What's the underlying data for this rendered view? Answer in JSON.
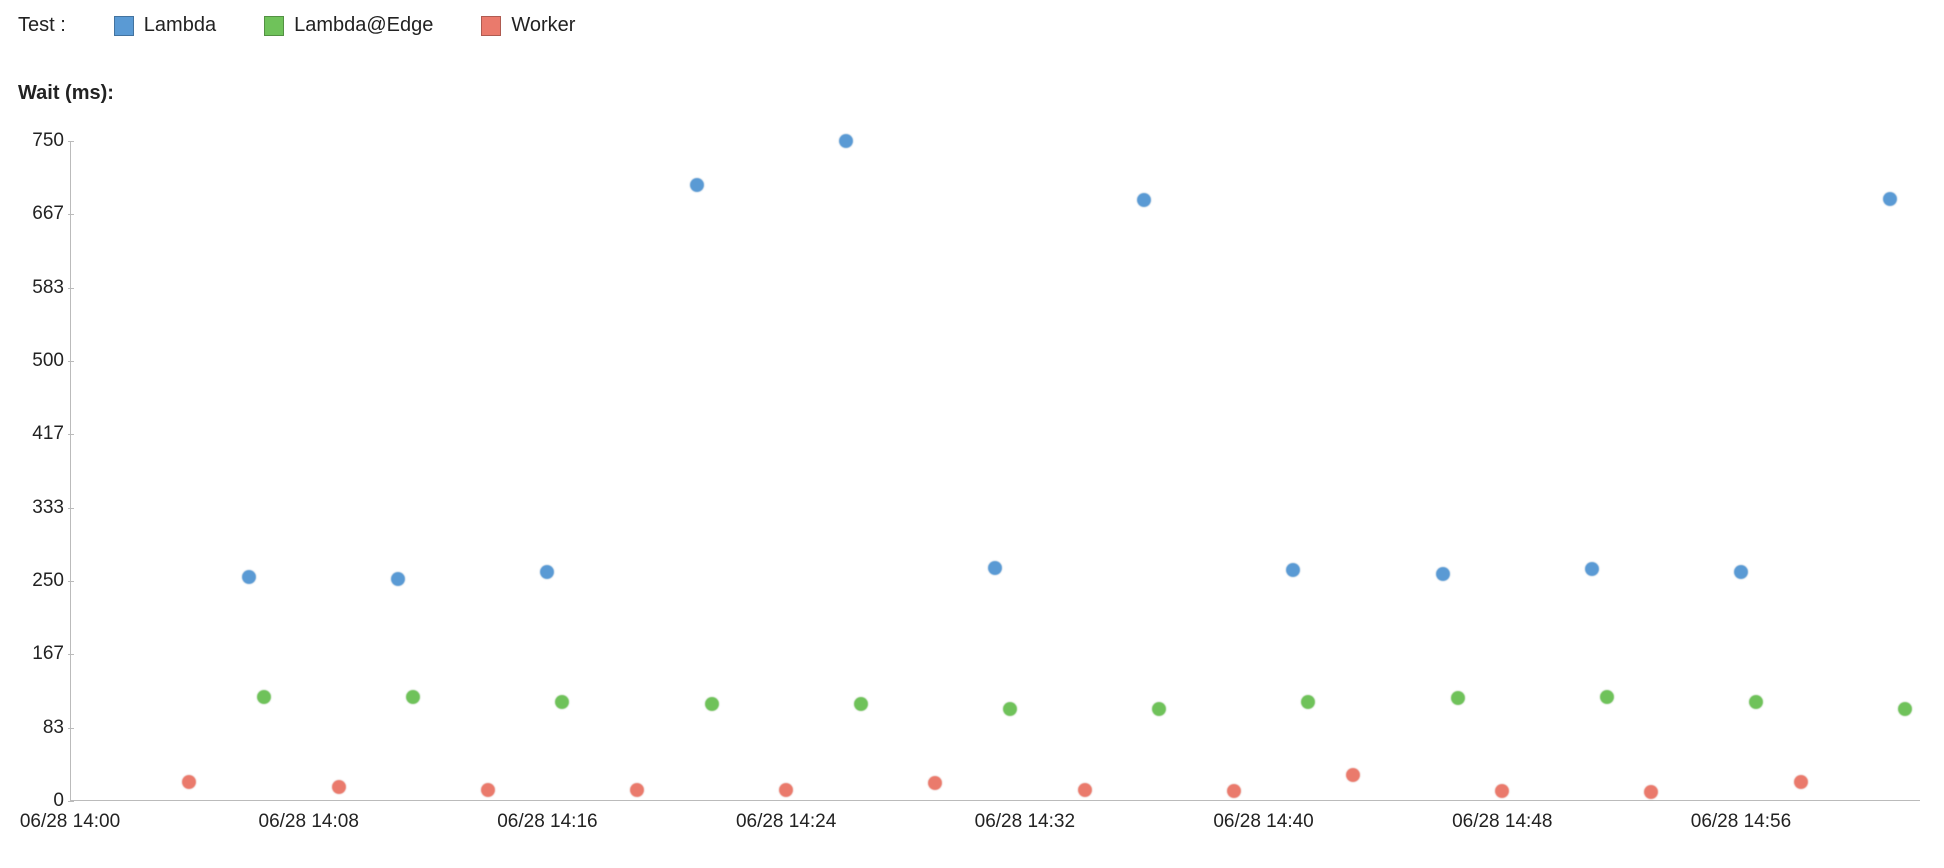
{
  "legend": {
    "prefix": "Test :",
    "items": [
      {
        "label": "Lambda",
        "color": "#5a9ad4"
      },
      {
        "label": "Lambda@Edge",
        "color": "#6fc25a"
      },
      {
        "label": "Worker",
        "color": "#ea7a6c"
      }
    ]
  },
  "title": "Wait (ms):",
  "chart_data": {
    "type": "scatter",
    "xlabel": "",
    "ylabel": "",
    "ylim": [
      0,
      750
    ],
    "xlim": [
      0,
      62
    ],
    "y_ticks": [
      0,
      83,
      167,
      250,
      333,
      417,
      500,
      583,
      667,
      750
    ],
    "x_ticks": [
      {
        "x": 0,
        "label": "06/28 14:00"
      },
      {
        "x": 8,
        "label": "06/28 14:08"
      },
      {
        "x": 16,
        "label": "06/28 14:16"
      },
      {
        "x": 24,
        "label": "06/28 14:24"
      },
      {
        "x": 32,
        "label": "06/28 14:32"
      },
      {
        "x": 40,
        "label": "06/28 14:40"
      },
      {
        "x": 48,
        "label": "06/28 14:48"
      },
      {
        "x": 56,
        "label": "06/28 14:56"
      }
    ],
    "series": [
      {
        "name": "Lambda",
        "color": "#5a9ad4",
        "points": [
          {
            "x": 6,
            "y": 255
          },
          {
            "x": 11,
            "y": 252
          },
          {
            "x": 16,
            "y": 260
          },
          {
            "x": 21,
            "y": 700
          },
          {
            "x": 26,
            "y": 750
          },
          {
            "x": 31,
            "y": 265
          },
          {
            "x": 36,
            "y": 683
          },
          {
            "x": 41,
            "y": 262
          },
          {
            "x": 46,
            "y": 258
          },
          {
            "x": 51,
            "y": 264
          },
          {
            "x": 56,
            "y": 260
          },
          {
            "x": 61,
            "y": 684
          }
        ]
      },
      {
        "name": "Lambda@Edge",
        "color": "#6fc25a",
        "points": [
          {
            "x": 6.5,
            "y": 118
          },
          {
            "x": 11.5,
            "y": 118
          },
          {
            "x": 16.5,
            "y": 112
          },
          {
            "x": 21.5,
            "y": 110
          },
          {
            "x": 26.5,
            "y": 110
          },
          {
            "x": 31.5,
            "y": 105
          },
          {
            "x": 36.5,
            "y": 105
          },
          {
            "x": 41.5,
            "y": 112
          },
          {
            "x": 46.5,
            "y": 117
          },
          {
            "x": 51.5,
            "y": 118
          },
          {
            "x": 56.5,
            "y": 113
          },
          {
            "x": 61.5,
            "y": 105
          }
        ]
      },
      {
        "name": "Worker",
        "color": "#ea7a6c",
        "points": [
          {
            "x": 4,
            "y": 22
          },
          {
            "x": 9,
            "y": 16
          },
          {
            "x": 14,
            "y": 12
          },
          {
            "x": 19,
            "y": 12
          },
          {
            "x": 24,
            "y": 13
          },
          {
            "x": 29,
            "y": 20
          },
          {
            "x": 34,
            "y": 12
          },
          {
            "x": 39,
            "y": 11
          },
          {
            "x": 43,
            "y": 30
          },
          {
            "x": 48,
            "y": 11
          },
          {
            "x": 53,
            "y": 10
          },
          {
            "x": 58,
            "y": 22
          }
        ]
      }
    ]
  }
}
